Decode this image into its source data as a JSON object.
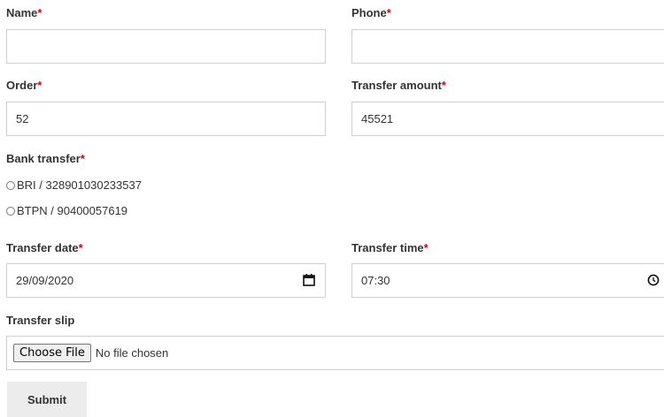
{
  "form": {
    "name": {
      "label": "Name",
      "required": "*",
      "value": ""
    },
    "phone": {
      "label": "Phone",
      "required": "*",
      "value": ""
    },
    "order": {
      "label": "Order",
      "required": "*",
      "value": "52"
    },
    "transfer_amount": {
      "label": "Transfer amount",
      "required": "*",
      "value": "45521"
    },
    "bank_transfer": {
      "label": "Bank transfer",
      "required": "*",
      "options": [
        {
          "label": "BRI / 328901030233537",
          "selected": false
        },
        {
          "label": "BTPN / 90400057619",
          "selected": false
        }
      ]
    },
    "transfer_date": {
      "label": "Transfer date",
      "required": "*",
      "value": "29/09/2020",
      "icon": "calendar-icon"
    },
    "transfer_time": {
      "label": "Transfer time",
      "required": "*",
      "value": "07:30",
      "icon": "clock-icon"
    },
    "transfer_slip": {
      "label": "Transfer slip",
      "button_label": "Choose File",
      "status": "No file chosen"
    },
    "submit_label": "Submit"
  },
  "colors": {
    "required_marker": "#d0021b",
    "border": "#cfcfcf",
    "button_bg": "#ececec"
  }
}
